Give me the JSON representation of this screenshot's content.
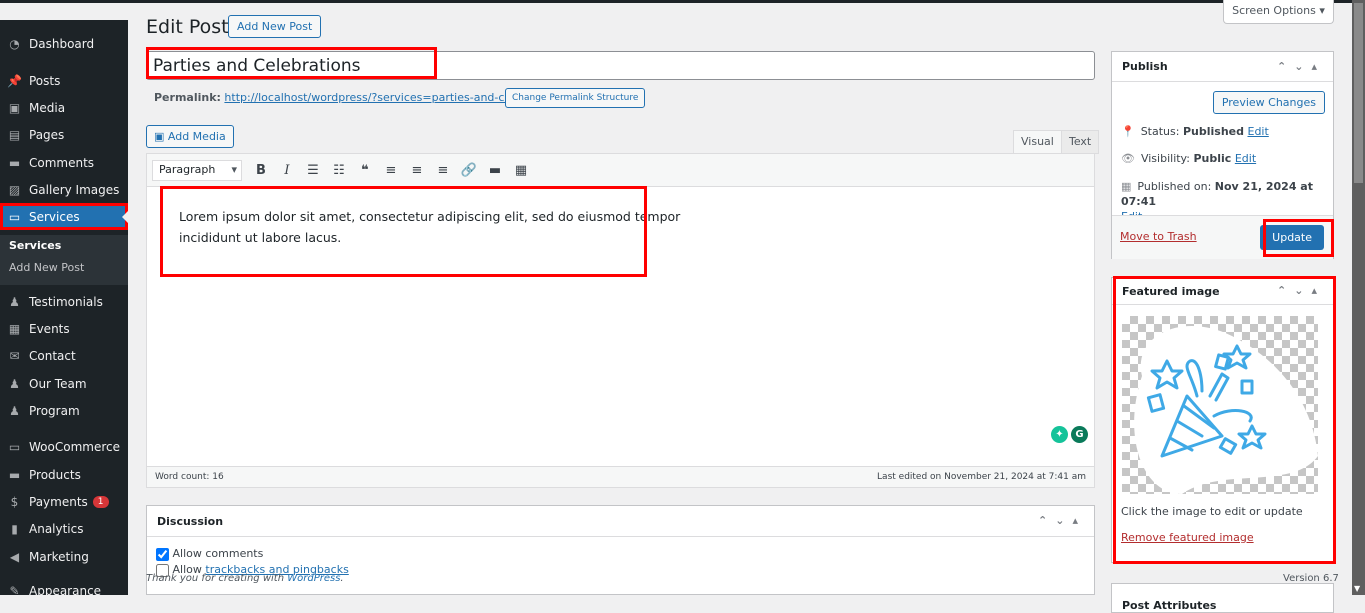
{
  "sidebar": {
    "items": [
      {
        "label": "Dashboard",
        "icon": "dashboard-icon"
      },
      {
        "label": "Posts",
        "icon": "pin-icon"
      },
      {
        "label": "Media",
        "icon": "media-icon"
      },
      {
        "label": "Pages",
        "icon": "pages-icon"
      },
      {
        "label": "Comments",
        "icon": "comment-icon"
      },
      {
        "label": "Gallery Images",
        "icon": "gallery-icon"
      },
      {
        "label": "Services",
        "icon": "folder-icon"
      },
      {
        "label": "Testimonials",
        "icon": "person-icon"
      },
      {
        "label": "Events",
        "icon": "calendar-icon"
      },
      {
        "label": "Contact",
        "icon": "envelope-icon"
      },
      {
        "label": "Our Team",
        "icon": "person-icon"
      },
      {
        "label": "Program",
        "icon": "person-icon"
      },
      {
        "label": "WooCommerce",
        "icon": "woo-icon"
      },
      {
        "label": "Products",
        "icon": "archive-icon"
      },
      {
        "label": "Payments",
        "icon": "dollar-icon",
        "badge": "1"
      },
      {
        "label": "Analytics",
        "icon": "bar-chart-icon"
      },
      {
        "label": "Marketing",
        "icon": "megaphone-icon"
      },
      {
        "label": "Appearance",
        "icon": "brush-icon"
      }
    ],
    "submenu": [
      "Services",
      "Add New Post"
    ]
  },
  "header": {
    "title": "Edit Post",
    "add_new": "Add New Post",
    "screen_options": "Screen Options ▾"
  },
  "post": {
    "title": "Parties and Celebrations",
    "permalink_label": "Permalink:",
    "permalink_url": "http://localhost/wordpress/?services=parties-and-celebrations",
    "change_permalink": "Change Permalink Structure"
  },
  "editor": {
    "add_media": "Add Media",
    "tab_visual": "Visual",
    "tab_text": "Text",
    "format": "Paragraph",
    "content_line1": "Lorem ipsum dolor sit amet, consectetur adipiscing elit, sed do eiusmod tempor",
    "content_line2": "incididunt ut labore lacus.",
    "word_count": "Word count: 16",
    "last_edited": "Last edited on November 21, 2024 at 7:41 am"
  },
  "discussion": {
    "title": "Discussion",
    "allow_comments": "Allow comments",
    "allow_comments_checked": true,
    "allow_prefix": "Allow",
    "trackbacks_link": "trackbacks and pingbacks",
    "trackbacks_checked": false
  },
  "publish": {
    "title": "Publish",
    "preview": "Preview Changes",
    "status_label": "Status:",
    "status": "Published",
    "visibility_label": "Visibility:",
    "visibility": "Public",
    "published_label": "Published on:",
    "published": "Nov 21, 2024 at 07:41",
    "edit": "Edit",
    "trash": "Move to Trash",
    "update": "Update"
  },
  "featured": {
    "title": "Featured image",
    "hint": "Click the image to edit or update",
    "remove": "Remove featured image"
  },
  "post_attributes": {
    "title": "Post Attributes"
  },
  "footer": {
    "thanks": "Thank you for creating with",
    "wp": "WordPress",
    "version": "Version 6.7"
  },
  "colors": {
    "accent": "#2271b1",
    "sidebar": "#1d2327",
    "highlight": "#ff0000",
    "danger": "#b32d2e"
  }
}
